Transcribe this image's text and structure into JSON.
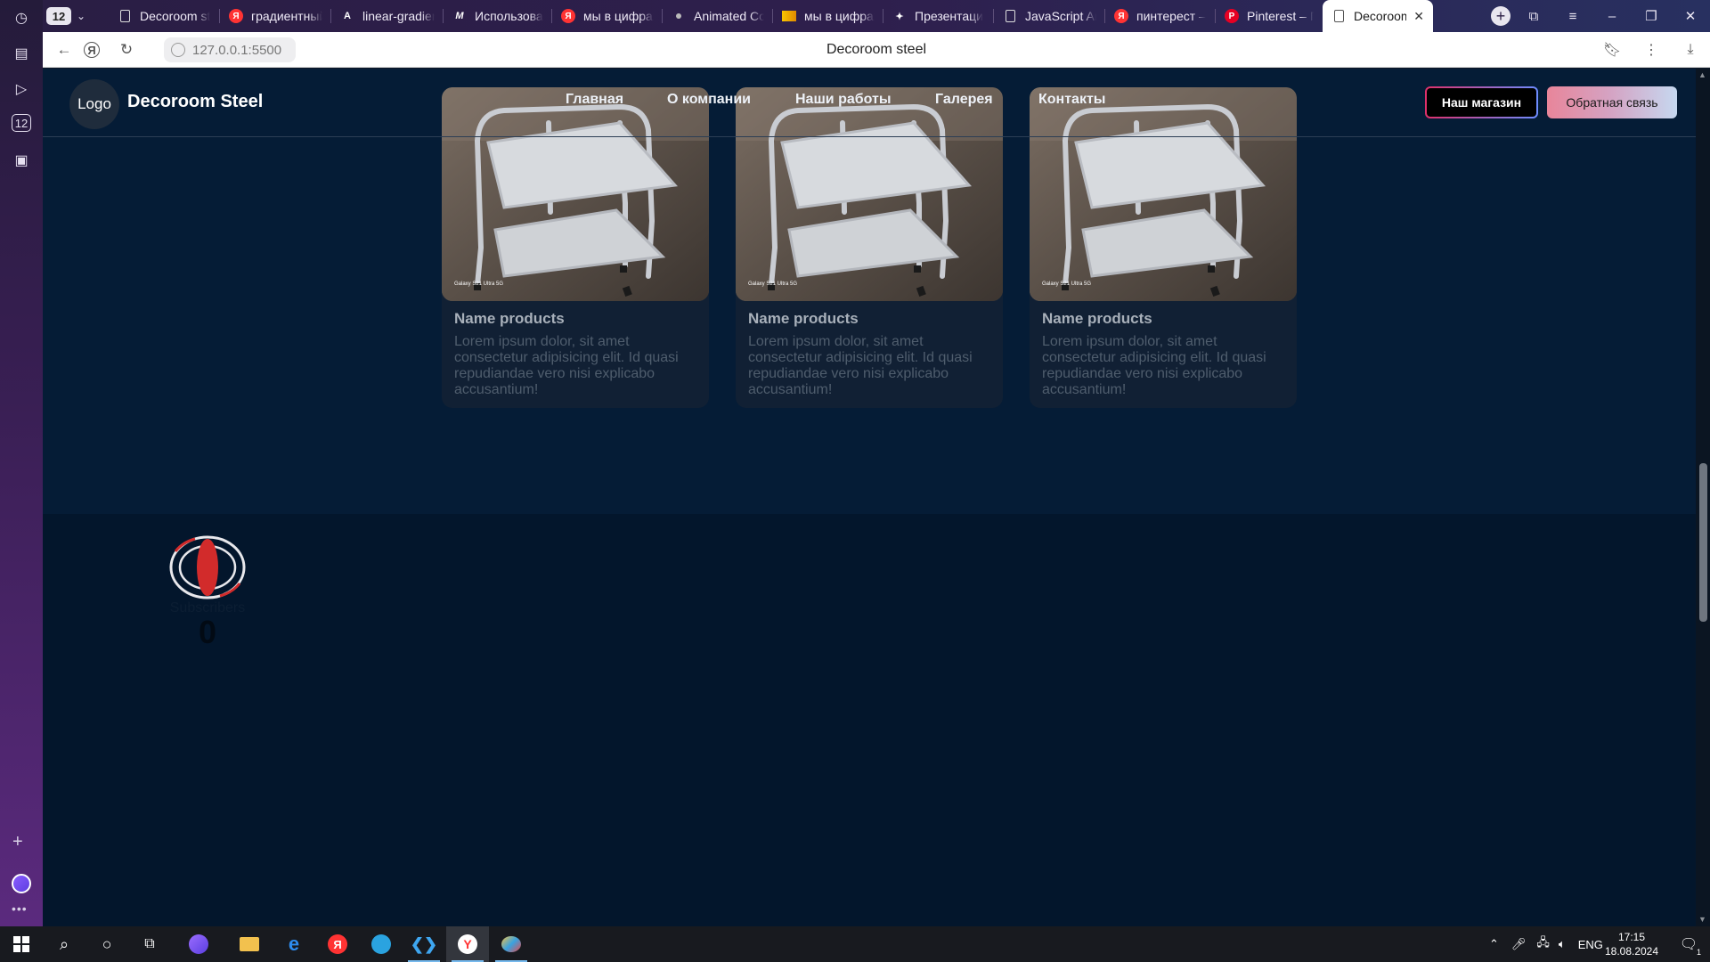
{
  "browser": {
    "tab_count": "12",
    "tabs": [
      {
        "title": "Decoroom st",
        "favicon": "doc",
        "active": false
      },
      {
        "title": "градиентный",
        "favicon": "yandex",
        "active": false
      },
      {
        "title": "linear-gradier",
        "favicon": "mdn",
        "active": false
      },
      {
        "title": "Использован",
        "favicon": "m",
        "active": false
      },
      {
        "title": "мы в цифрах",
        "favicon": "yandex",
        "active": false
      },
      {
        "title": "Animated Co",
        "favicon": "dot",
        "active": false
      },
      {
        "title": "мы в цифрах",
        "favicon": "bookmark",
        "active": false
      },
      {
        "title": "Презентаци",
        "favicon": "sparkle",
        "active": false
      },
      {
        "title": "JavaScript Ar",
        "favicon": "doc",
        "active": false
      },
      {
        "title": "пинтерест –",
        "favicon": "yandex",
        "active": false
      },
      {
        "title": "Pinterest – Пi",
        "favicon": "pinterest",
        "active": false
      },
      {
        "title": "Decoroom",
        "favicon": "doc",
        "active": true
      }
    ],
    "url": "127.0.0.1:5500",
    "page_title": "Decoroom steel"
  },
  "site": {
    "logo_text": "Logo",
    "brand": "Decoroom Steel",
    "nav": [
      "Главная",
      "О компании",
      "Наши работы",
      "Галерея",
      "Контакты"
    ],
    "shop_button": "Наш магазин",
    "feedback_button": "Обратная связь"
  },
  "products": [
    {
      "name": "Name products",
      "description": "Lorem ipsum dolor, sit amet consectetur adipisicing elit. Id quasi repudiandae vero nisi explicabo accusantium!",
      "camera_caption": "Galaxy S21 Ultra 5G"
    },
    {
      "name": "Name products",
      "description": "Lorem ipsum dolor, sit amet consectetur adipisicing elit. Id quasi repudiandae vero nisi explicabo accusantium!",
      "camera_caption": "Galaxy S21 Ultra 5G"
    },
    {
      "name": "Name products",
      "description": "Lorem ipsum dolor, sit amet consectetur adipisicing elit. Id quasi repudiandae vero nisi explicabo accusantium!",
      "camera_caption": "Galaxy S21 Ultra 5G"
    }
  ],
  "stats": {
    "label": "Subscribers",
    "value": "0"
  },
  "taskbar": {
    "language": "ENG",
    "time": "17:15",
    "date": "18.08.2024",
    "notifications": "1"
  },
  "colors": {
    "page_bg": "#051c36",
    "lower_bg": "#03162c",
    "card_bg": "#112034",
    "accent_pink": "#e0306a",
    "subscriber_icon_red": "#d22b2b"
  }
}
